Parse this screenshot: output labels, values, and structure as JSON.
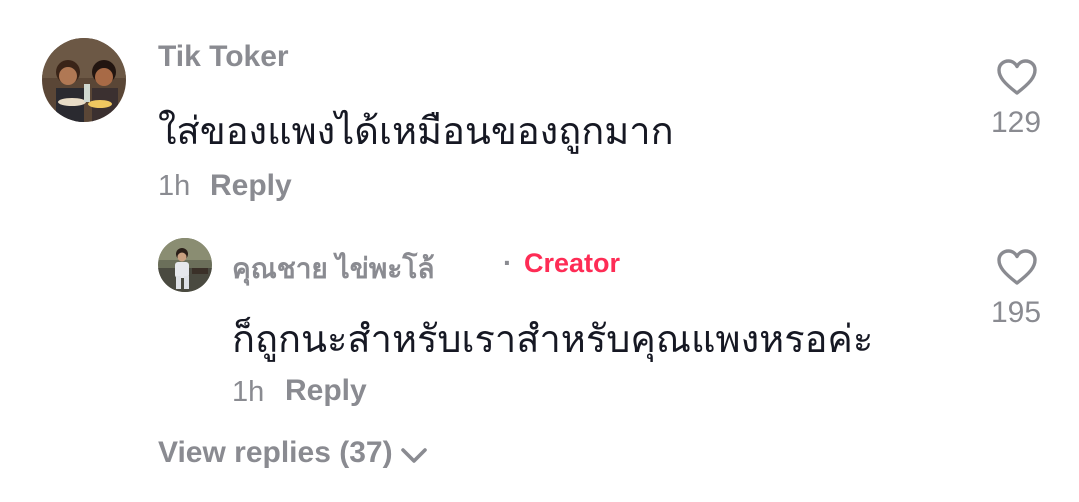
{
  "comment": {
    "username": "Tik Toker",
    "text": "ใส่ของแพงได้เหมือนของถูกมาก",
    "time": "1h",
    "reply_label": "Reply",
    "like_count": "129",
    "like_icon": "heart-outline-icon"
  },
  "reply_comment": {
    "username": "คุณชาย ไข่พะโล้",
    "separator": "·",
    "badge": "Creator",
    "text": "ก็ถูกนะสำหรับเราสำหรับคุณแพงหรอค่ะ",
    "time": "1h",
    "reply_label": "Reply",
    "like_count": "195",
    "like_icon": "heart-outline-icon"
  },
  "view_replies": {
    "label": "View replies (37)",
    "icon": "chevron-down-icon"
  },
  "colors": {
    "muted": "#8a8b91",
    "text": "#161823",
    "creator": "#fe2c55"
  }
}
